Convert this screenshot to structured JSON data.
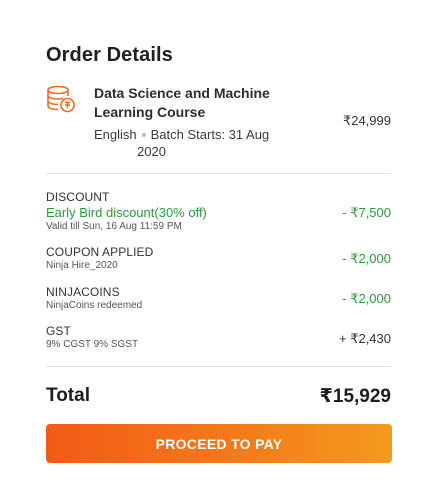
{
  "header": {
    "title": "Order Details"
  },
  "course": {
    "icon": "database-coin-icon",
    "name": "Data Science and Machine Learning Course",
    "language": "English",
    "batch_label": "Batch Starts: 31 Aug",
    "batch_year": "2020",
    "price": "₹24,999"
  },
  "adjustments": {
    "discount": {
      "label": "DISCOUNT",
      "name": "Early Bird discount(30% off)",
      "validity": "Valid till Sun, 16 Aug 11:59 PM",
      "amount": "- ₹7,500"
    },
    "coupon": {
      "label": "COUPON APPLIED",
      "code": "Ninja Hire_2020",
      "amount": "- ₹2,000"
    },
    "ninjacoins": {
      "label": "NINJACOINS",
      "note": "NinjaCoins redeemed",
      "amount": "- ₹2,000"
    },
    "gst": {
      "label": "GST",
      "note": "9% CGST 9% SGST",
      "amount": "+ ₹2,430"
    }
  },
  "total": {
    "label": "Total",
    "value": "₹15,929"
  },
  "actions": {
    "pay_label": "PROCEED TO PAY"
  },
  "colors": {
    "accent_start": "#f35a16",
    "accent_end": "#f39a1d",
    "discount_green": "#2f9a3c"
  }
}
